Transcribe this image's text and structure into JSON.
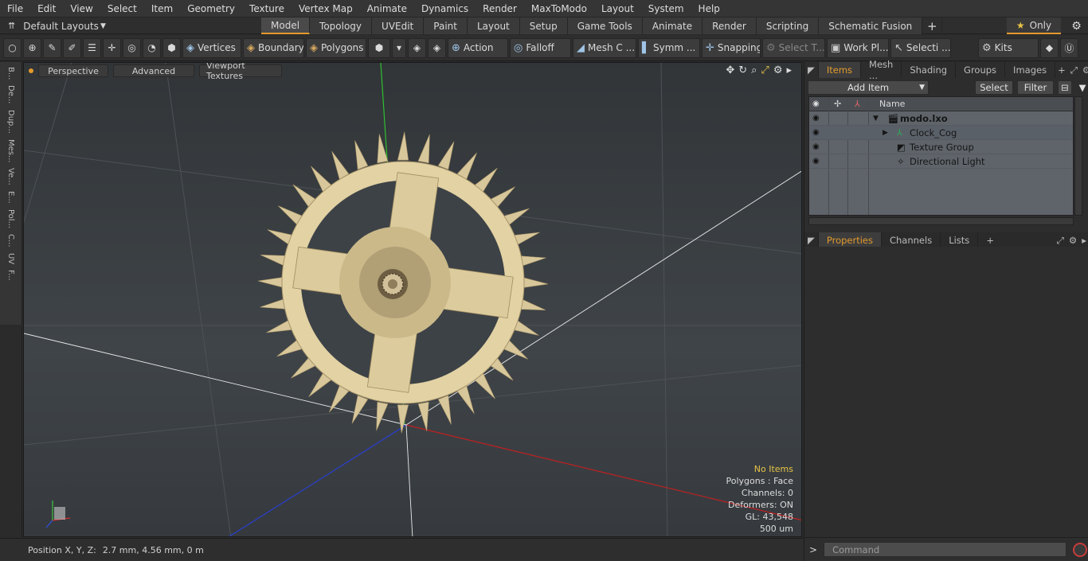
{
  "menu": [
    "File",
    "Edit",
    "View",
    "Select",
    "Item",
    "Geometry",
    "Texture",
    "Vertex Map",
    "Animate",
    "Dynamics",
    "Render",
    "MaxToModo",
    "Layout",
    "System",
    "Help"
  ],
  "layouts_label": "Default Layouts",
  "tabs": [
    {
      "label": "Model",
      "active": true
    },
    {
      "label": "Topology"
    },
    {
      "label": "UVEdit"
    },
    {
      "label": "Paint"
    },
    {
      "label": "Layout"
    },
    {
      "label": "Setup"
    },
    {
      "label": "Game Tools"
    },
    {
      "label": "Animate"
    },
    {
      "label": "Render"
    },
    {
      "label": "Scripting"
    },
    {
      "label": "Schematic Fusion"
    }
  ],
  "only_label": "Only",
  "toolbar": {
    "vertices": "Vertices",
    "boundary": "Boundary",
    "polygons": "Polygons",
    "action": "Action",
    "falloff": "Falloff",
    "meshc": "Mesh C ...",
    "symm": "Symm ...",
    "snapping": "Snapping",
    "selectt": "Select T...",
    "workpl": "Work Pl...",
    "selecti": "Selecti ...",
    "kits": "Kits"
  },
  "left_tabs": [
    "B...",
    "De...",
    "Dup...",
    "Mes...",
    "Ve...",
    "E...",
    "Pol...",
    "C...",
    "UV",
    "F..."
  ],
  "viewport": {
    "perspective": "Perspective",
    "advanced": "Advanced",
    "textures": "Viewport Textures",
    "info": {
      "items": "No Items",
      "polygons": "Polygons : Face",
      "channels": "Channels: 0",
      "deformers": "Deformers: ON",
      "gl": "GL: 43,548",
      "unit": "500 um"
    }
  },
  "status": {
    "label": "Position X, Y, Z:",
    "value": "2.7 mm, 4.56 mm, 0 m"
  },
  "items_panel": {
    "tabs": [
      "Items",
      "Mesh ...",
      "Shading",
      "Groups",
      "Images"
    ],
    "add_item": "Add Item",
    "select": "Select",
    "filter": "Filter",
    "name_header": "Name",
    "rows": [
      {
        "label": "modo.lxo",
        "bold": true
      },
      {
        "label": "Clock_Cog"
      },
      {
        "label": "Texture Group"
      },
      {
        "label": "Directional Light"
      }
    ]
  },
  "props_panel": {
    "tabs": [
      "Properties",
      "Channels",
      "Lists"
    ]
  },
  "command_placeholder": "Command"
}
